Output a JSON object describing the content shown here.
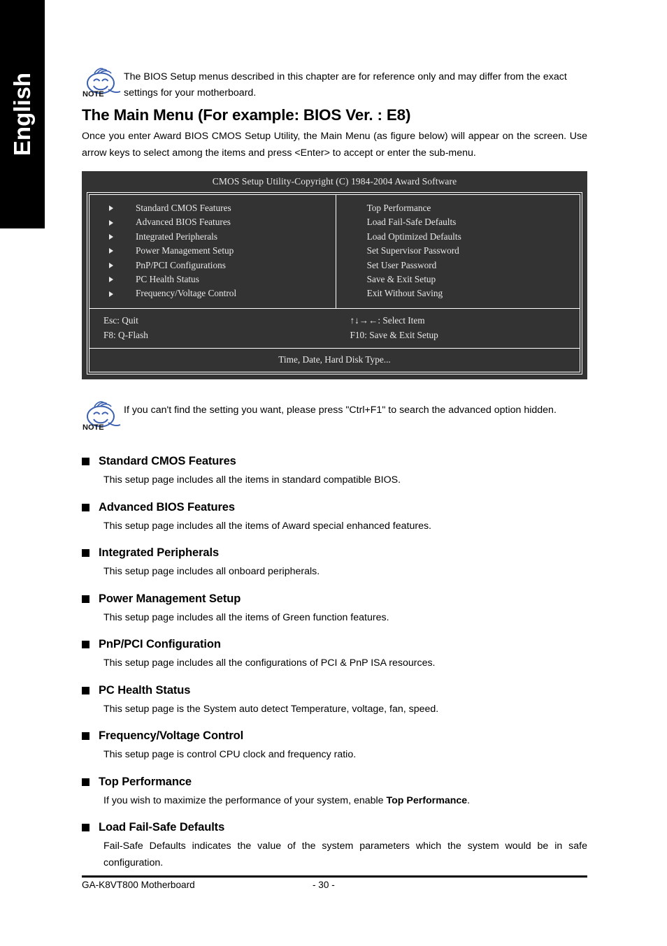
{
  "sidebar": {
    "language_label": "English"
  },
  "notes": [
    {
      "icon": "note-smiley-icon",
      "badge": "NOTE",
      "text": "The BIOS Setup menus described in this chapter are for reference only and may differ from the exact settings for your motherboard."
    },
    {
      "icon": "note-smiley-icon",
      "badge": "NOTE",
      "text": "If you can't find the setting you want, please press \"Ctrl+F1\" to search the advanced option hidden."
    }
  ],
  "heading": "The Main Menu (For example: BIOS Ver. : E8)",
  "intro": "Once you enter Award BIOS CMOS Setup Utility, the Main Menu (as figure below) will appear on the screen.  Use arrow keys to select among the items and press <Enter> to accept or enter the sub-menu.",
  "bios": {
    "title": "CMOS Setup Utility-Copyright (C) 1984-2004 Award Software",
    "left_items": [
      "Standard CMOS Features",
      "Advanced BIOS Features",
      "Integrated Peripherals",
      "Power Management Setup",
      "PnP/PCI Configurations",
      "PC Health Status",
      "Frequency/Voltage Control"
    ],
    "right_items": [
      "Top Performance",
      "Load Fail-Safe Defaults",
      "Load Optimized Defaults",
      "Set Supervisor Password",
      "Set User Password",
      "Save & Exit Setup",
      "Exit Without Saving"
    ],
    "keys_left": [
      "Esc: Quit",
      "F8: Q-Flash"
    ],
    "keys_right": [
      "↑↓→←: Select Item",
      "F10: Save & Exit Setup"
    ],
    "status_bar": "Time, Date, Hard Disk Type...",
    "background_color": "#333334",
    "text_color": "#e8e8e8",
    "border_color": "#ffffff"
  },
  "sections": [
    {
      "title": "Standard CMOS Features",
      "body": "This setup page includes all the items in standard compatible BIOS."
    },
    {
      "title": "Advanced BIOS Features",
      "body": "This setup page includes all the items of Award special enhanced features."
    },
    {
      "title": "Integrated Peripherals",
      "body": "This setup page includes all onboard peripherals."
    },
    {
      "title": "Power Management Setup",
      "body": "This setup page includes all the items of Green function features."
    },
    {
      "title": "PnP/PCI Configuration",
      "body": "This setup page includes all the configurations of PCI & PnP ISA resources."
    },
    {
      "title": "PC Health Status",
      "body": "This setup page is the System auto detect Temperature, voltage, fan, speed."
    },
    {
      "title": "Frequency/Voltage Control",
      "body": "This setup page is control CPU clock and frequency ratio."
    },
    {
      "title": "Top Performance",
      "body_pre": "If you wish to maximize the performance of your system, enable ",
      "body_bold": "Top Performance",
      "body_post": "."
    },
    {
      "title": "Load Fail-Safe Defaults",
      "body": "Fail-Safe Defaults indicates the value of the system parameters which the system would be in safe configuration."
    }
  ],
  "footer": {
    "left": "GA-K8VT800 Motherboard",
    "page": "- 30 -"
  }
}
